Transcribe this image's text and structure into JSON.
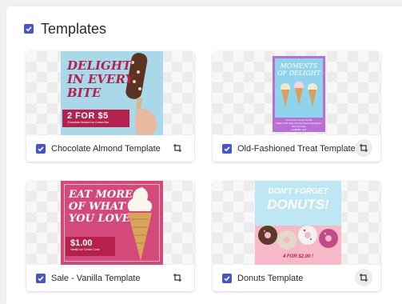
{
  "section": {
    "title": "Templates",
    "checked": true
  },
  "templates": [
    {
      "label": "Chocolate Almond Template",
      "checked": true,
      "art": {
        "line1": "DELIGHT",
        "line2": "IN EVERY",
        "line3": "BITE",
        "price": "2 FOR $5",
        "caption": "Chocolate Almond Ice Cream Bar"
      }
    },
    {
      "label": "Old-Fashioned Treat Template",
      "checked": true,
      "art": {
        "line1": "MOMENTS",
        "line2": "OF DELIGHT",
        "sub": "Ice Cream Cones For $2",
        "fine": "Made fresh daily with the finest ingredients. Visit us today.",
        "tag": "Available now"
      }
    },
    {
      "label": "Sale - Vanilla Template",
      "checked": true,
      "art": {
        "line1": "EAT MORE",
        "line2": "OF WHAT",
        "line3": "YOU LOVE",
        "price": "$1.00",
        "caption": "Vanilla Ice Cream Cone"
      }
    },
    {
      "label": "Donuts Template",
      "checked": true,
      "art": {
        "line1": "DON'T FORGET",
        "line2": "DONUTS!",
        "price": "4 FOR $2.00 !"
      }
    }
  ]
}
